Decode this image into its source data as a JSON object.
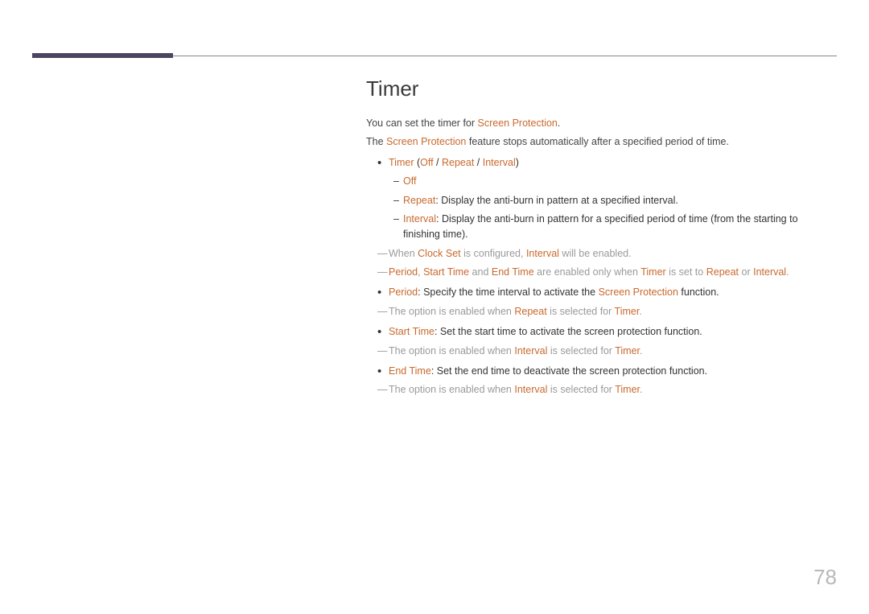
{
  "title": "Timer",
  "intro1_a": "You can set the timer for ",
  "intro1_b": "Screen Protection",
  "intro1_c": ".",
  "intro2_a": "The ",
  "intro2_b": "Screen Protection",
  "intro2_c": " feature stops automatically after a specified period of time.",
  "b1": {
    "timer": "Timer",
    "open": " (",
    "off": "Off",
    "s1": " / ",
    "repeat": "Repeat",
    "s2": " / ",
    "interval": "Interval",
    "close": ")"
  },
  "b1a": "Off",
  "b1b": {
    "k": "Repeat",
    "t": ": Display the anti-burn in pattern at a specified interval."
  },
  "b1c": {
    "k": "Interval",
    "t": ": Display the anti-burn in pattern for a specified period of time (from the starting to finishing time)."
  },
  "n1": {
    "a": "When ",
    "b": "Clock Set",
    "c": " is configured, ",
    "d": "Interval",
    "e": " will be enabled."
  },
  "n2": {
    "a": "Period",
    "b": ", ",
    "c": "Start Time",
    "d": " and ",
    "e": "End Time",
    "f": " are enabled only when ",
    "g": "Timer",
    "h": " is set to ",
    "i": "Repeat",
    "j": " or ",
    "k": "Interval",
    "l": "."
  },
  "b2": {
    "k": "Period",
    "t": ": Specify the time interval to activate the ",
    "sp": "Screen Protection",
    "end": " function."
  },
  "n3": {
    "a": "The option is enabled when ",
    "b": "Repeat",
    "c": " is selected for ",
    "d": "Timer",
    "e": "."
  },
  "b3": {
    "k": "Start Time",
    "t": ": Set the start time to activate the screen protection function."
  },
  "n4": {
    "a": "The option is enabled when ",
    "b": "Interval",
    "c": " is selected for ",
    "d": "Timer",
    "e": "."
  },
  "b4": {
    "k": "End Time",
    "t": ": Set the end time to deactivate the screen protection function."
  },
  "n5": {
    "a": "The option is enabled when ",
    "b": "Interval",
    "c": " is selected for ",
    "d": "Timer",
    "e": "."
  },
  "pageNum": "78"
}
